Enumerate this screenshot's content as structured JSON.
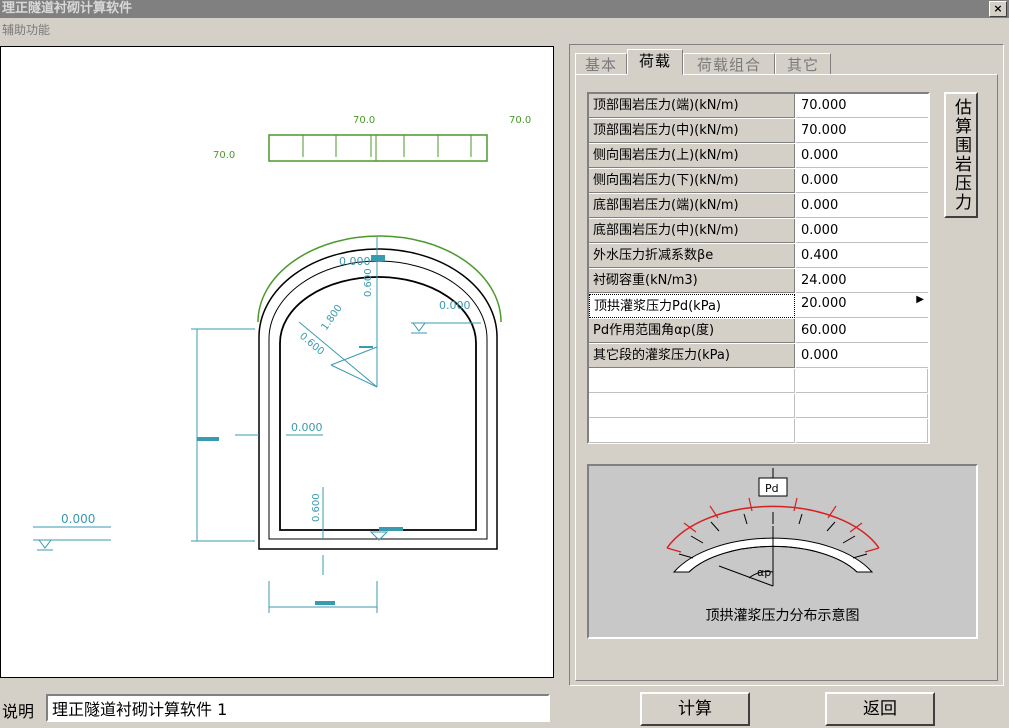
{
  "window": {
    "title": "理正隧道衬砌计算软件",
    "close_label": "×"
  },
  "menu": {
    "items": [
      "辅助功能"
    ]
  },
  "drawing": {
    "top_load_labels": [
      "70.0",
      "70.0",
      "70.0"
    ],
    "dims": [
      "0.000",
      "0.000",
      "0.600",
      "1.800",
      "0.600",
      "0.000",
      "0.600",
      "0.000"
    ]
  },
  "tabs": [
    {
      "label": "基本",
      "active": false
    },
    {
      "label": "荷载",
      "active": true
    },
    {
      "label": "荷载组合",
      "active": false
    },
    {
      "label": "其它",
      "active": false
    }
  ],
  "params": [
    {
      "label": "顶部围岩压力(端)(kN/m)",
      "value": "70.000"
    },
    {
      "label": "顶部围岩压力(中)(kN/m)",
      "value": "70.000"
    },
    {
      "label": "侧向围岩压力(上)(kN/m)",
      "value": "0.000"
    },
    {
      "label": "侧向围岩压力(下)(kN/m)",
      "value": "0.000"
    },
    {
      "label": "底部围岩压力(端)(kN/m)",
      "value": "0.000"
    },
    {
      "label": "底部围岩压力(中)(kN/m)",
      "value": "0.000"
    },
    {
      "label": "外水压力折减系数βe",
      "value": "0.400"
    },
    {
      "label": "衬砌容重(kN/m3)",
      "value": "24.000"
    },
    {
      "label": "顶拱灌浆压力Pd(kPa)",
      "value": "20.000",
      "selected": true
    },
    {
      "label": "Pd作用范围角αp(度)",
      "value": "60.000"
    },
    {
      "label": "其它段的灌浆压力(kPa)",
      "value": "0.000"
    }
  ],
  "estimate_button": "估算围岩压力",
  "diagram": {
    "pd_label": "Pd",
    "alpha_label": "αp",
    "caption": "顶拱灌浆压力分布示意图"
  },
  "bottom": {
    "desc_label": "说明",
    "desc_value": "理正隧道衬砌计算软件 1",
    "calc_button": "计算",
    "back_button": "返回"
  },
  "colors": {
    "load": "#4a9a2a",
    "dim": "#3a9ab0",
    "pd": "#d62020"
  }
}
